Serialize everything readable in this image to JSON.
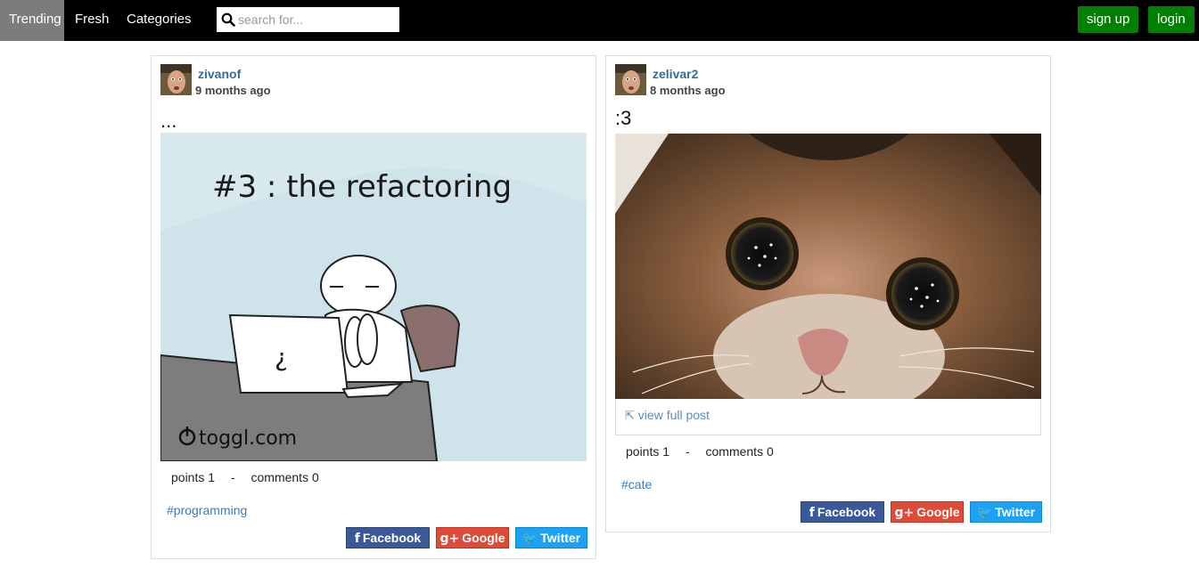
{
  "nav": {
    "items": [
      {
        "label": "Trending"
      },
      {
        "label": "Fresh"
      },
      {
        "label": "Categories"
      }
    ],
    "search_placeholder": "search for...",
    "signup_label": "sign up",
    "login_label": "login"
  },
  "posts": [
    {
      "username": "zivanof",
      "time": "9 months ago",
      "title": "...",
      "image_text": "#3 : the refactoring",
      "watermark": "toggl.com",
      "points_label": "points 1",
      "separator": "-",
      "comments_label": "comments 0",
      "tag": "#programming",
      "share": {
        "facebook": "Facebook",
        "google": "Google",
        "twitter": "Twitter"
      }
    },
    {
      "username": "zelivar2",
      "time": "8 months ago",
      "title": ":3",
      "view_full_post": "view full post",
      "points_label": "points 1",
      "separator": "-",
      "comments_label": "comments 0",
      "tag": "#cate",
      "share": {
        "facebook": "Facebook",
        "google": "Google",
        "twitter": "Twitter"
      }
    }
  ]
}
